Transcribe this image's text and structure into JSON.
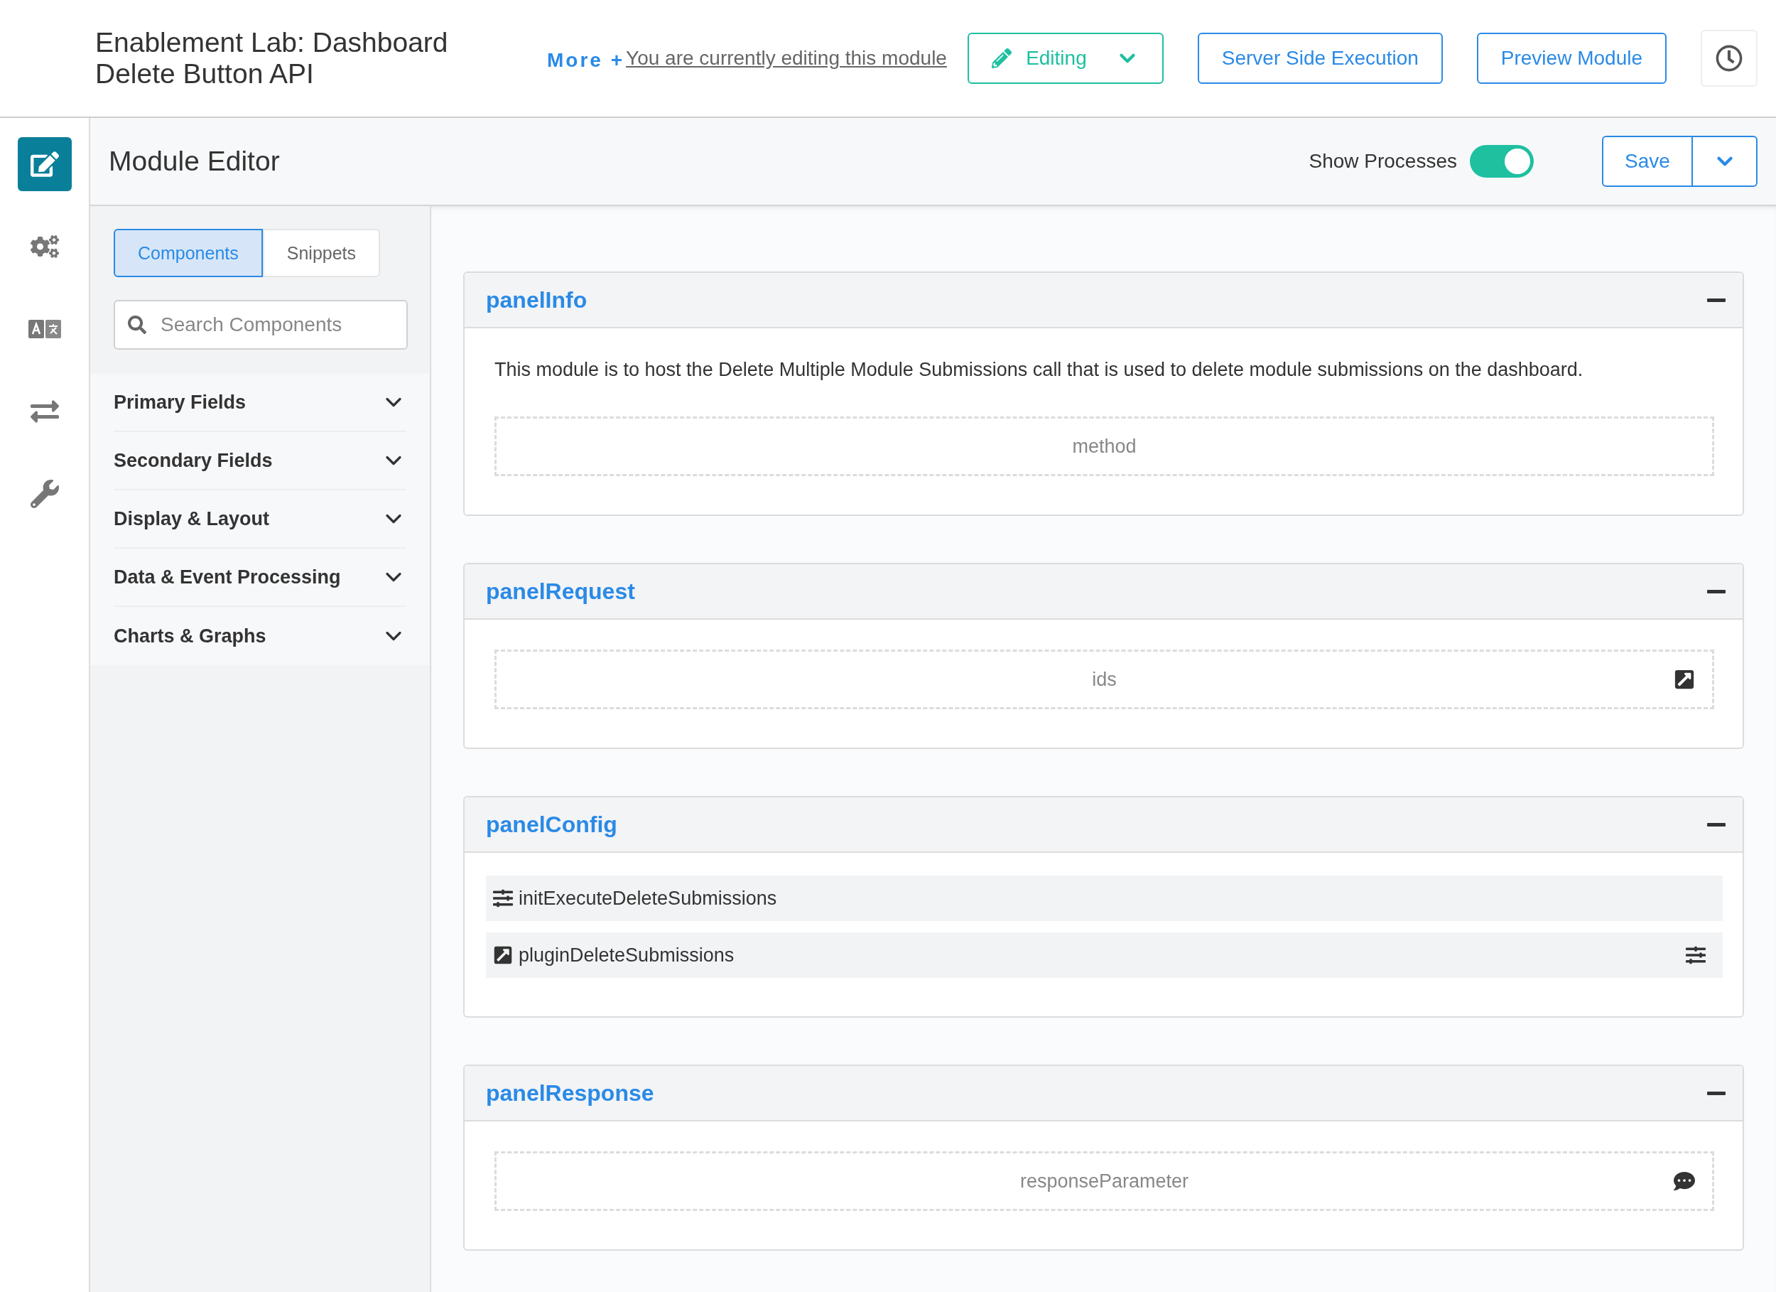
{
  "header": {
    "title": "Enablement Lab: Dashboard Delete Button API",
    "more": "More +",
    "editing_link": "You are currently editing this module",
    "mode_button": "Editing",
    "buttons": [
      "Server Side Execution",
      "Preview Module"
    ]
  },
  "toolbar": {
    "title": "Module Editor",
    "toggle": {
      "label": "Show Processes",
      "on": true
    },
    "save": "Save"
  },
  "sidebar": {
    "tabs": [
      {
        "label": "Components",
        "selected": true
      },
      {
        "label": "Snippets",
        "selected": false
      }
    ],
    "search": {
      "placeholder": "Search Components"
    },
    "groups": [
      {
        "label": "Primary Fields",
        "expanded": false
      },
      {
        "label": "Secondary Fields",
        "expanded": false
      },
      {
        "label": "Display & Layout",
        "expanded": false
      },
      {
        "label": "Data & Event Processing",
        "expanded": false
      },
      {
        "label": "Charts & Graphs",
        "expanded": false
      }
    ]
  },
  "panels": [
    {
      "title": "panelInfo",
      "expanded": true,
      "items": [
        {
          "kind": "text",
          "text": "This module is to host the Delete Multiple Module Submissions call that is used to delete module submissions on the dashboard."
        },
        {
          "kind": "field",
          "text": "method"
        }
      ]
    },
    {
      "title": "panelRequest",
      "expanded": true,
      "items": [
        {
          "kind": "plugin-field",
          "text": "ids"
        }
      ]
    },
    {
      "title": "panelConfig",
      "expanded": true,
      "items": [
        {
          "kind": "process",
          "text": "initExecuteDeleteSubmissions"
        },
        {
          "kind": "plugin",
          "text": "pluginDeleteSubmissions"
        }
      ]
    },
    {
      "title": "panelResponse",
      "expanded": true,
      "items": [
        {
          "kind": "message-field",
          "text": "responseParameter"
        }
      ]
    }
  ]
}
